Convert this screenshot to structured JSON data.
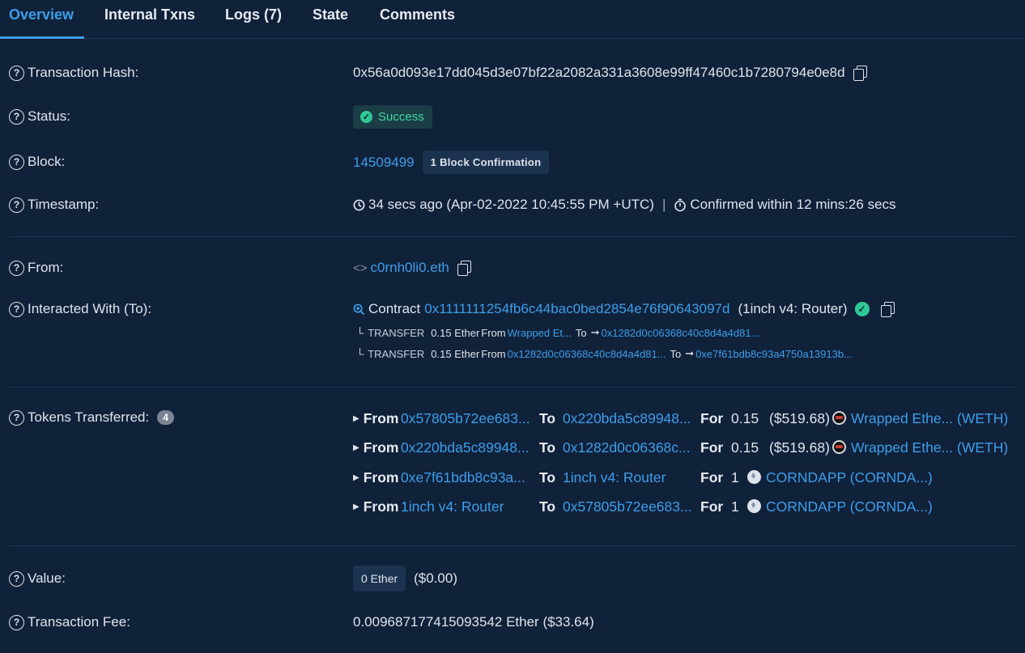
{
  "tabs": [
    {
      "label": "Overview",
      "active": true
    },
    {
      "label": "Internal Txns"
    },
    {
      "label": "Logs (7)"
    },
    {
      "label": "State"
    },
    {
      "label": "Comments"
    }
  ],
  "labels": {
    "tx_hash": "Transaction Hash:",
    "status": "Status:",
    "block": "Block:",
    "timestamp": "Timestamp:",
    "from": "From:",
    "interacted": "Interacted With (To):",
    "tokens": "Tokens Transferred:",
    "value": "Value:",
    "fee": "Transaction Fee:"
  },
  "tx_hash": "0x56a0d093e17dd045d3e07bf22a2082a331a3608e99ff47460c1b7280794e0e8d",
  "status": "Success",
  "block": {
    "number": "14509499",
    "confirmations": "1 Block Confirmation"
  },
  "timestamp": {
    "ago": "34 secs ago (Apr-02-2022 10:45:55 PM +UTC)",
    "sep": "|",
    "confirmed": "Confirmed within 12 mins:26 secs"
  },
  "from": "c0rnh0li0.eth",
  "interacted": {
    "prefix": "Contract",
    "address": "0x1111111254fb6c44bac0bed2854e76f90643097d",
    "name": "(1inch v4: Router)",
    "transfers": [
      {
        "label": "TRANSFER",
        "amount": "0.15 Ether",
        "from_word": "From",
        "from": "Wrapped Et...",
        "to_word": "To",
        "to": "0x1282d0c06368c40c8d4a4d81..."
      },
      {
        "label": "TRANSFER",
        "amount": "0.15 Ether",
        "from_word": "From",
        "from": "0x1282d0c06368c40c8d4a4d81...",
        "to_word": "To",
        "to": "0xe7f61bdb8c93a4750a13913b..."
      }
    ]
  },
  "tokens": {
    "count": "4",
    "from_word": "From",
    "to_word": "To",
    "for_word": "For",
    "rows": [
      {
        "from": "0x57805b72ee683...",
        "to": "0x220bda5c89948...",
        "amount": "0.15",
        "usd": "($519.68)",
        "token": "Wrapped Ethe... (WETH)",
        "icon": "weth-icon"
      },
      {
        "from": "0x220bda5c89948...",
        "to": "0x1282d0c06368c...",
        "amount": "0.15",
        "usd": "($519.68)",
        "token": "Wrapped Ethe... (WETH)",
        "icon": "weth-icon"
      },
      {
        "from": "0xe7f61bdb8c93a...",
        "to": "1inch v4: Router",
        "amount": "1",
        "usd": "",
        "token": "CORNDAPP (CORNDA...)",
        "icon": "eth-icon"
      },
      {
        "from": "1inch v4: Router",
        "to": "0x57805b72ee683...",
        "amount": "1",
        "usd": "",
        "token": "CORNDAPP (CORNDA...)",
        "icon": "eth-icon"
      }
    ]
  },
  "value": {
    "badge": "0 Ether",
    "usd": "($0.00)"
  },
  "fee": "0.009687177415093542 Ether ($33.64)"
}
